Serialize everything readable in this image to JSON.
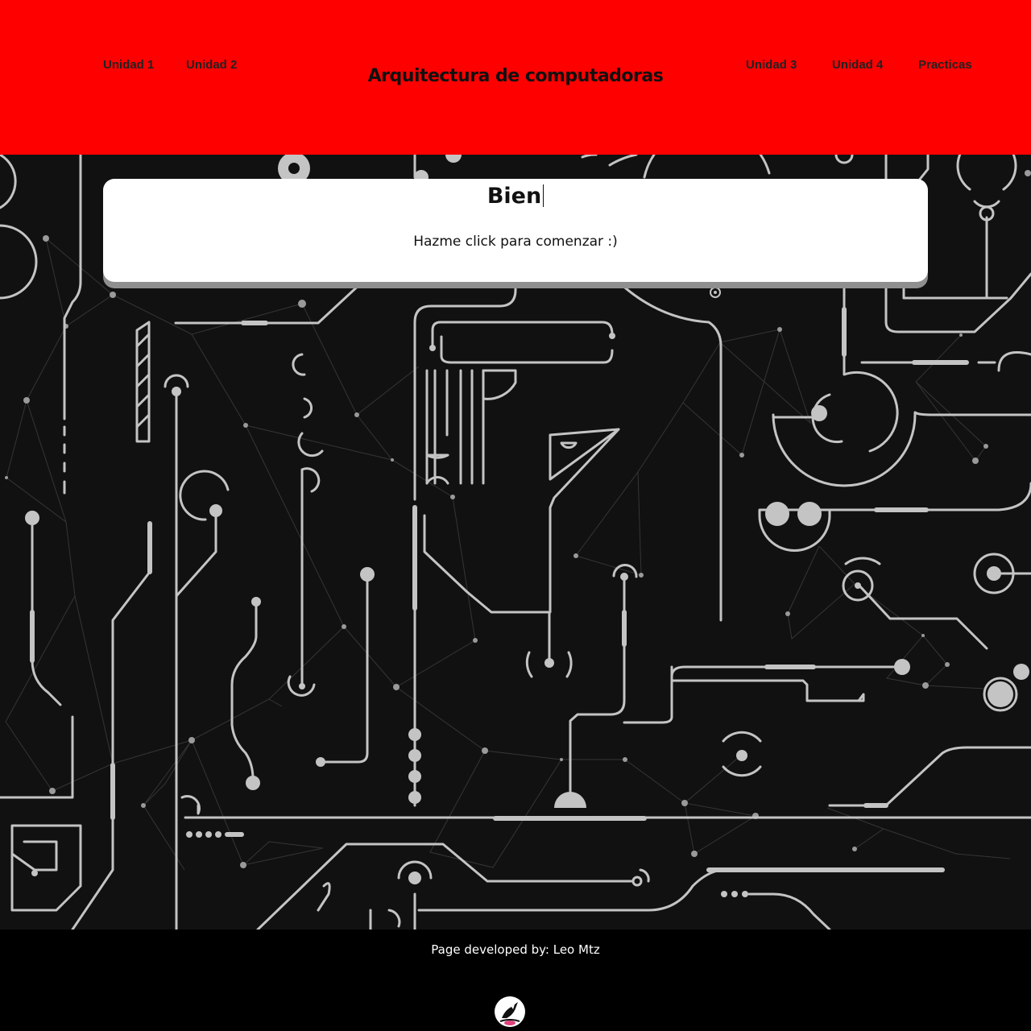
{
  "header": {
    "title": "Arquitectura de computadoras",
    "nav": [
      "Unidad 1",
      "Unidad 2",
      "Unidad 3",
      "Unidad 4",
      "Practicas"
    ]
  },
  "card": {
    "title": "Bien",
    "subtitle": "Hazme click para comenzar :)"
  },
  "footer": {
    "credit": "Page developed by: Leo Mtz",
    "logo_icon": "magpie-bird-logo-icon"
  },
  "colors": {
    "header_bg": "#ff0000",
    "background": "#111111",
    "circuit": "#bdbdbd",
    "footer_bg": "#000000"
  }
}
